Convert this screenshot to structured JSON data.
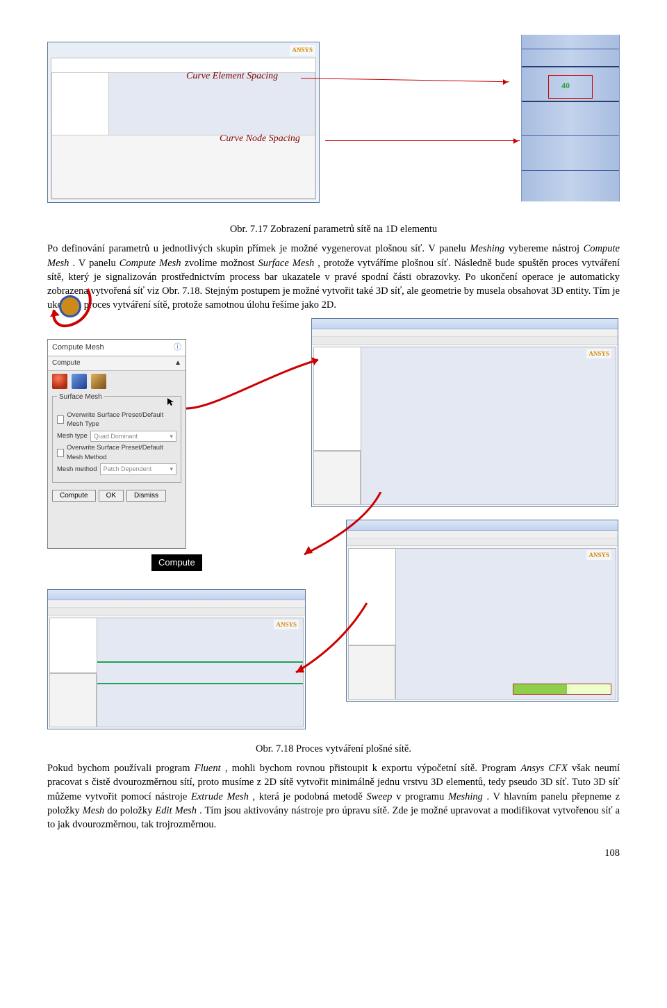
{
  "fig_top": {
    "annotation1": "Curve Element Spacing",
    "annotation2": "Curve Node Spacing",
    "mark_value": "40",
    "logo": "ANSYS",
    "caption": "Obr. 7.17 Zobrazení parametrů sítě na 1D elementu"
  },
  "para1_a": "Po definování parametrů u jednotlivých skupin přímek je možné vygenerovat plošnou síť. V panelu ",
  "para1_b": "Meshing",
  "para1_c": " vybereme nástroj ",
  "para1_d": "Compute Mesh",
  "para1_e": " . V panelu ",
  "para1_f": "Compute Mesh",
  "para1_g": " zvolíme možnost ",
  "para1_h": "Surface Mesh",
  "para1_i": " , protože vytváříme plošnou síť. Následně bude spuštěn proces vytváření sítě, který je signalizován prostřednictvím process bar ukazatele v pravé spodní části obrazovky. Po ukončení operace je automaticky zobrazena vytvořená síť viz Obr. 7.18. Stejným postupem je možné vytvořit také 3D síť, ale geometrie by musela obsahovat 3D entity. Tím je ukončen proces vytváření sítě, protože samotnou úlohu řešíme jako 2D.",
  "compute_panel": {
    "title": "Compute Mesh",
    "subtitle": "Compute",
    "group_title": "Surface Mesh",
    "row1": "Overwrite Surface Preset/Default Mesh Type",
    "meshtype_label": "Mesh type",
    "meshtype_value": "Quad Dominant",
    "row2": "Overwrite Surface Preset/Default Mesh Method",
    "meshmethod_label": "Mesh method",
    "meshmethod_value": "Patch Dependent",
    "btn_compute": "Compute",
    "btn_ok": "OK",
    "btn_dismiss": "Dismiss",
    "tooltip": "Compute"
  },
  "fig_mid_caption": "Obr. 7.18 Proces vytváření plošné sítě.",
  "para2_a": "Pokud bychom používali program ",
  "para2_b": "Fluent",
  "para2_c": ", mohli bychom rovnou přistoupit k exportu výpočetní sítě. Program ",
  "para2_d": "Ansys CFX",
  "para2_e": " však neumí pracovat s čistě dvourozměrnou sítí, proto musíme z 2D sítě vytvořit minimálně jednu vrstvu 3D elementů, tedy pseudo 3D síť. Tuto 3D síť můžeme vytvořit pomocí nástroje ",
  "para2_f": "Extrude Mesh",
  "para2_g": ", která je podobná metodě ",
  "para2_h": "Sweep",
  "para2_i": " v programu ",
  "para2_j": "Meshing",
  "para2_k": ". V hlavním panelu přepneme z položky ",
  "para2_l": "Mesh",
  "para2_m": " do položky ",
  "para2_n": "Edit Mesh",
  "para2_o": ". Tím jsou aktivovány nástroje pro úpravu sítě. Zde je možné upravovat a modifikovat vytvořenou síť a to jak dvourozměrnou, tak trojrozměrnou.",
  "page_number": "108"
}
